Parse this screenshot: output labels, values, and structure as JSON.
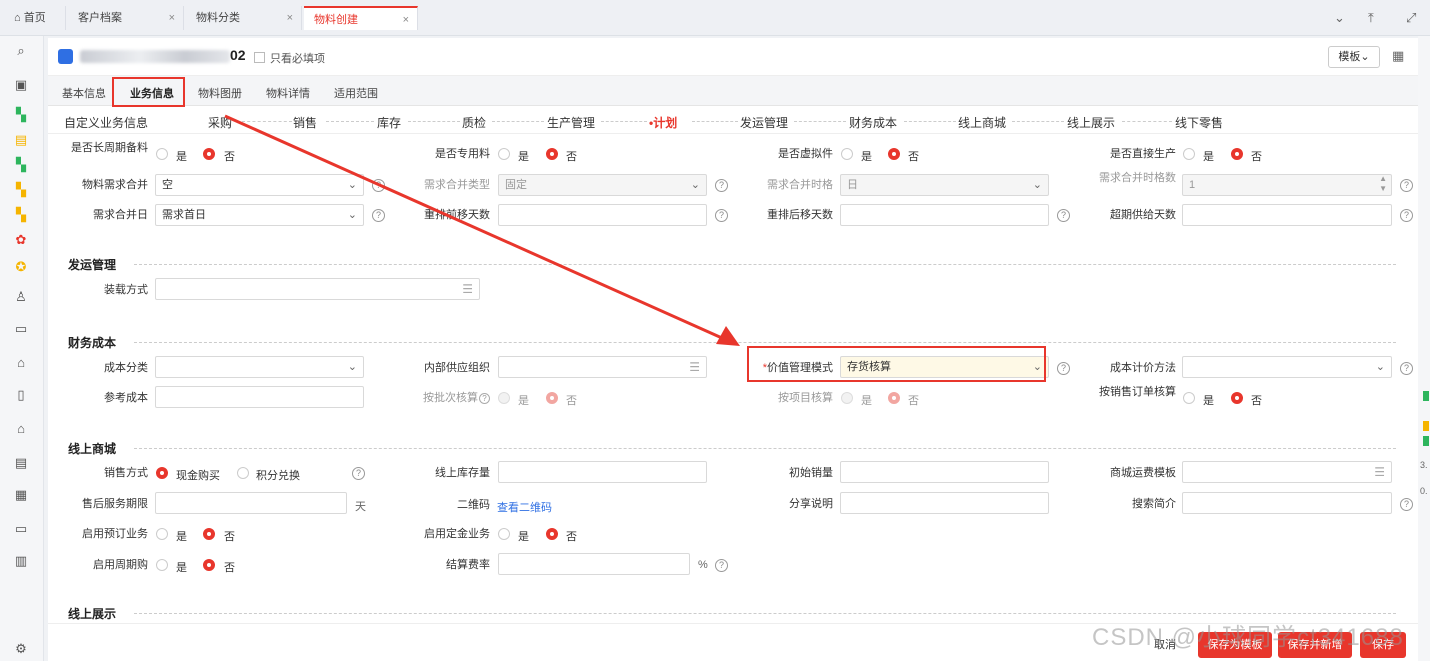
{
  "window_tabs": [
    {
      "label": "首页",
      "icon": "home-icon"
    },
    {
      "label": "客户档案",
      "close": "×"
    },
    {
      "label": "物料分类",
      "close": "×"
    },
    {
      "label": "物料创建",
      "close": "×"
    }
  ],
  "header": {
    "title_suffix": "02",
    "only_required_label": "只看必填项",
    "template_label": "模板"
  },
  "sub_tabs": [
    "基本信息",
    "业务信息",
    "物料图册",
    "物料详情",
    "适用范围"
  ],
  "steps": [
    "自定义业务信息",
    "采购",
    "销售",
    "库存",
    "质检",
    "生产管理",
    "•计划",
    "发运管理",
    "财务成本",
    "线上商城",
    "线上展示",
    "线下零售"
  ],
  "yes": "是",
  "no": "否",
  "plan": {
    "long_cycle": "是否长周期备料",
    "dedicated": "是否专用料",
    "virtual": "是否虚拟件",
    "direct_prod": "是否直接生产",
    "merge": {
      "label": "物料需求合并",
      "value": "空"
    },
    "merge_type": {
      "label": "需求合并类型",
      "value": "固定"
    },
    "merge_period": {
      "label": "需求合并时格",
      "value": "日"
    },
    "merge_period_num": {
      "label": "需求合并时格数",
      "value": "1"
    },
    "merge_day": {
      "label": "需求合并日",
      "value": "需求首日"
    },
    "resched_fwd": "重排前移天数",
    "resched_back": "重排后移天数",
    "overdue_days": "超期供给天数"
  },
  "shipping": {
    "title": "发运管理",
    "loading": "装载方式"
  },
  "finance": {
    "title": "财务成本",
    "cost_class": "成本分类",
    "internal_org": "内部供应组织",
    "value_mode": {
      "label": "价值管理模式",
      "value": "存货核算",
      "required": "*"
    },
    "cost_method": "成本计价方法",
    "ref_cost": "参考成本",
    "batch_acct": "按批次核算",
    "project_acct": "按项目核算",
    "order_acct": "按销售订单核算"
  },
  "online_mall": {
    "title": "线上商城",
    "sale_mode": "销售方式",
    "cash": "现金购买",
    "points": "积分兑换",
    "online_stock": "线上库存量",
    "initial_sales": "初始销量",
    "shipping_tpl": "商城运费模板",
    "after_sale": "售后服务期限",
    "day_unit": "天",
    "qrcode": "二维码",
    "qrcode_link": "查看二维码",
    "share": "分享说明",
    "search_intro": "搜索简介",
    "preorder": "启用预订业务",
    "deposit": "启用定金业务",
    "periodic": "启用周期购",
    "settle_rate": "结算费率",
    "percent": "%"
  },
  "online_display": {
    "title": "线上展示"
  },
  "footer": {
    "cancel": "取消",
    "save_tpl": "保存为模板",
    "save_new": "保存并新增",
    "save": "保存"
  },
  "right_strip": {
    "v1": "3.",
    "v2": "0."
  },
  "watermark": "CSDN @小球同学ct341688",
  "colors": {
    "accent": "#e8362c",
    "link": "#2f6fe3",
    "highlight": "#fef9e6"
  }
}
